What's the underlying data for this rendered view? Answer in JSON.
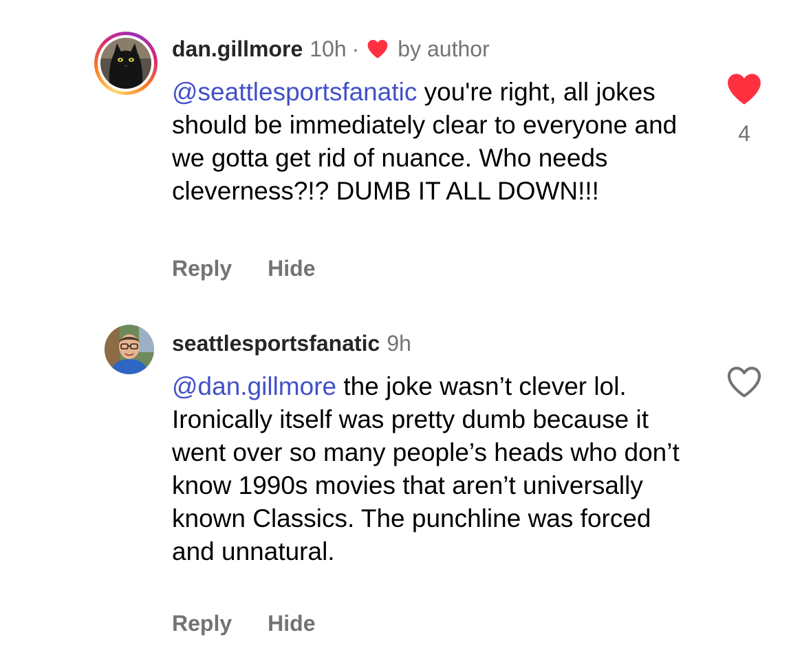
{
  "comments": [
    {
      "username": "dan.gillmore",
      "time": "10h",
      "separator": "·",
      "author_badge": "by author",
      "mention": "@seattlesportsfanatic",
      "text": " you're right, all jokes should be immediately clear to everyone and we gotta get rid of nuance. Who needs cleverness?!? DUMB IT ALL DOWN!!!",
      "reply_label": "Reply",
      "hide_label": "Hide",
      "liked": true,
      "like_count": "4",
      "avatar_icon": "black-cat-avatar",
      "story_ring": true
    },
    {
      "username": "seattlesportsfanatic",
      "time": "9h",
      "mention": "@dan.gillmore",
      "text": " the joke wasn’t clever lol. Ironically itself was pretty dumb because it went over so many people’s heads who don’t know 1990s movies that aren’t universally known Classics. The punchline was forced and unnatural.",
      "reply_label": "Reply",
      "hide_label": "Hide",
      "liked": false,
      "avatar_icon": "man-with-glasses-avatar"
    }
  ],
  "colors": {
    "mention": "#4150c8",
    "like_red": "#ff3040",
    "muted_text": "#737373",
    "username": "#262626"
  }
}
